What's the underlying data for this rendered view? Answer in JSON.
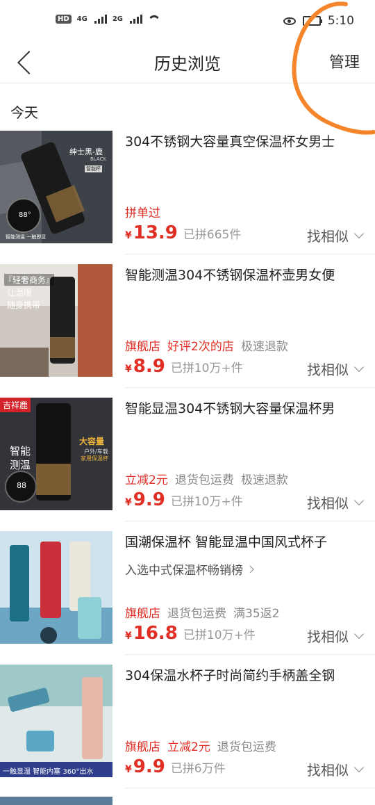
{
  "status_bar": {
    "hd": "HD",
    "net1": "4G",
    "net2": "2G",
    "time": "5:10"
  },
  "nav": {
    "title": "历史浏览",
    "manage": "管理"
  },
  "section": "今天",
  "items": [
    {
      "title": "304不锈钢大容量真空保温杯女男士",
      "tags": [
        {
          "text": "拼单过",
          "color": "red"
        }
      ],
      "price": "13.9",
      "sold": "已拼665件",
      "similar": "找相似",
      "thumb_text": {
        "a": "绅士黑-鹿",
        "b": "BLACK",
        "c": "智能杯",
        "d": "88°",
        "e": "智能测温 一触即显"
      }
    },
    {
      "title": "智能测温304不锈钢保温杯壶男女便",
      "tags": [
        {
          "text": "旗舰店",
          "color": "red"
        },
        {
          "text": "好评2次的店",
          "color": "red"
        },
        {
          "text": "极速退款",
          "color": "gray"
        }
      ],
      "price": "8.9",
      "sold": "已拼10万+件",
      "similar": "找相似",
      "thumb_text": {
        "a": "『轻奢商务』",
        "b": "让温暖",
        "c": "随身携带"
      }
    },
    {
      "title": "智能显温304不锈钢大容量保温杯男",
      "tags": [
        {
          "text": "立减2元",
          "color": "red"
        },
        {
          "text": "退货包运费",
          "color": "gray"
        },
        {
          "text": "极速退款",
          "color": "gray"
        }
      ],
      "price": "9.9",
      "sold": "已拼10万+件",
      "similar": "找相似",
      "thumb_text": {
        "badge": "吉祥鹿",
        "a": "智能",
        "b": "测温",
        "c": "大容量",
        "d": "户外/车载",
        "e": "家用保温杯",
        "f": "88"
      }
    },
    {
      "title": "国潮保温杯 智能显温中国风式杯子",
      "rank": "入选中式保温杯畅销榜",
      "tags": [
        {
          "text": "旗舰店",
          "color": "red"
        },
        {
          "text": "退货包运费",
          "color": "gray"
        },
        {
          "text": "满35返2",
          "color": "gray"
        }
      ],
      "price": "16.8",
      "sold": "已拼10万+件",
      "similar": "找相似"
    },
    {
      "title": "304保温水杯子时尚简约手柄盖全钢",
      "tags": [
        {
          "text": "旗舰店",
          "color": "red"
        },
        {
          "text": "立减2元",
          "color": "red"
        },
        {
          "text": "退货包运费",
          "color": "gray"
        }
      ],
      "price": "9.9",
      "sold": "已拼6万件",
      "similar": "找相似",
      "thumb_text": {
        "a": "一触显温 智能内塞 360°出水"
      }
    }
  ],
  "colors": {
    "accent": "#e02e24",
    "annotation": "#f5852a"
  }
}
